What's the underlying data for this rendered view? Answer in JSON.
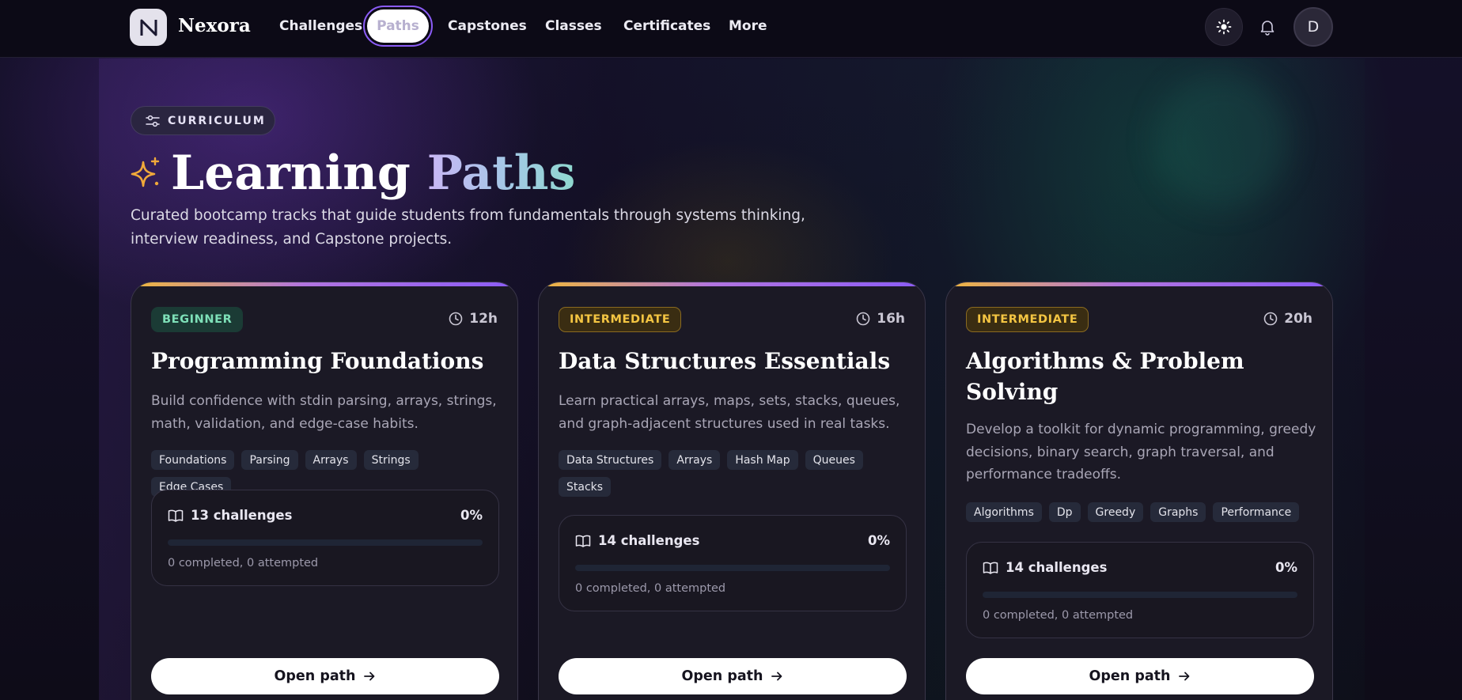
{
  "nav": {
    "brand": "Nexora",
    "links": [
      "Challenges",
      "Paths",
      "Capstones",
      "Classes",
      "Certificates",
      "More"
    ],
    "active": "Paths",
    "avatar_initial": "D"
  },
  "hero": {
    "badge": "CURRICULUM",
    "title_part1": "Learning",
    "title_part2": "Paths",
    "description": "Curated bootcamp tracks that guide students from fundamentals through systems thinking, interview readiness, and Capstone projects."
  },
  "colors": {
    "accent": "#8b5cf6",
    "beginner": "#7ee0b8",
    "intermediate": "#f4c542"
  },
  "cards": [
    {
      "level": "BEGINNER",
      "duration": "12h",
      "title": "Programming Foundations",
      "description": "Build confidence with stdin parsing, arrays, strings, math, validation, and edge-case habits.",
      "tags": [
        "Foundations",
        "Parsing",
        "Arrays",
        "Strings",
        "Edge Cases"
      ],
      "challenges": "13 challenges",
      "percent": "0%",
      "progress": 0,
      "progress_text": "0 completed, 0 attempted",
      "button": "Open path"
    },
    {
      "level": "INTERMEDIATE",
      "duration": "16h",
      "title": "Data Structures Essentials",
      "description": "Learn practical arrays, maps, sets, stacks, queues, and graph-adjacent structures used in real tasks.",
      "tags": [
        "Data Structures",
        "Arrays",
        "Hash Map",
        "Queues",
        "Stacks"
      ],
      "challenges": "14 challenges",
      "percent": "0%",
      "progress": 0,
      "progress_text": "0 completed, 0 attempted",
      "button": "Open path"
    },
    {
      "level": "INTERMEDIATE",
      "duration": "20h",
      "title": "Algorithms & Problem Solving",
      "description": "Develop a toolkit for dynamic programming, greedy decisions, binary search, graph traversal, and performance tradeoffs.",
      "tags": [
        "Algorithms",
        "Dp",
        "Greedy",
        "Graphs",
        "Performance"
      ],
      "challenges": "14 challenges",
      "percent": "0%",
      "progress": 0,
      "progress_text": "0 completed, 0 attempted",
      "button": "Open path"
    }
  ]
}
